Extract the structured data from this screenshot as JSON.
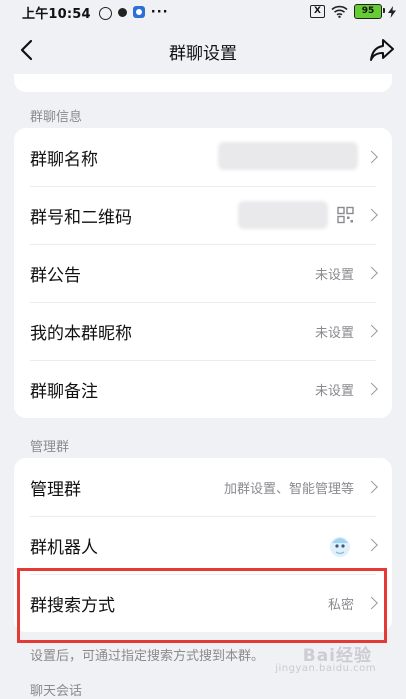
{
  "status_bar": {
    "time": "上午10:54",
    "more": "···",
    "close_box": "X",
    "battery": "95"
  },
  "nav": {
    "title": "群聊设置"
  },
  "sections": {
    "group_info_label": "群聊信息",
    "manage_label": "管理群",
    "chat_label": "聊天会话"
  },
  "group_info": {
    "rows": [
      {
        "label": "群聊名称",
        "value": ""
      },
      {
        "label": "群号和二维码",
        "value": ""
      },
      {
        "label": "群公告",
        "value": "未设置"
      },
      {
        "label": "我的本群昵称",
        "value": "未设置"
      },
      {
        "label": "群聊备注",
        "value": "未设置"
      }
    ]
  },
  "manage": {
    "rows": [
      {
        "label": "管理群",
        "value": "加群设置、智能管理等"
      },
      {
        "label": "群机器人",
        "value": ""
      },
      {
        "label": "群搜索方式",
        "value": "私密"
      }
    ]
  },
  "footer": {
    "note": "设置后，可通过指定搜索方式搜到本群。"
  },
  "watermark": {
    "text": "Bai经验",
    "sub": "jingyan.baidu.com"
  },
  "colors": {
    "background": "#f0f1f5",
    "highlight": "#e53935",
    "battery": "#66cc33"
  },
  "icons": [
    "chevron-left-icon",
    "share-icon",
    "qr-code-icon",
    "chevron-right-icon",
    "robot-avatar-icon"
  ]
}
